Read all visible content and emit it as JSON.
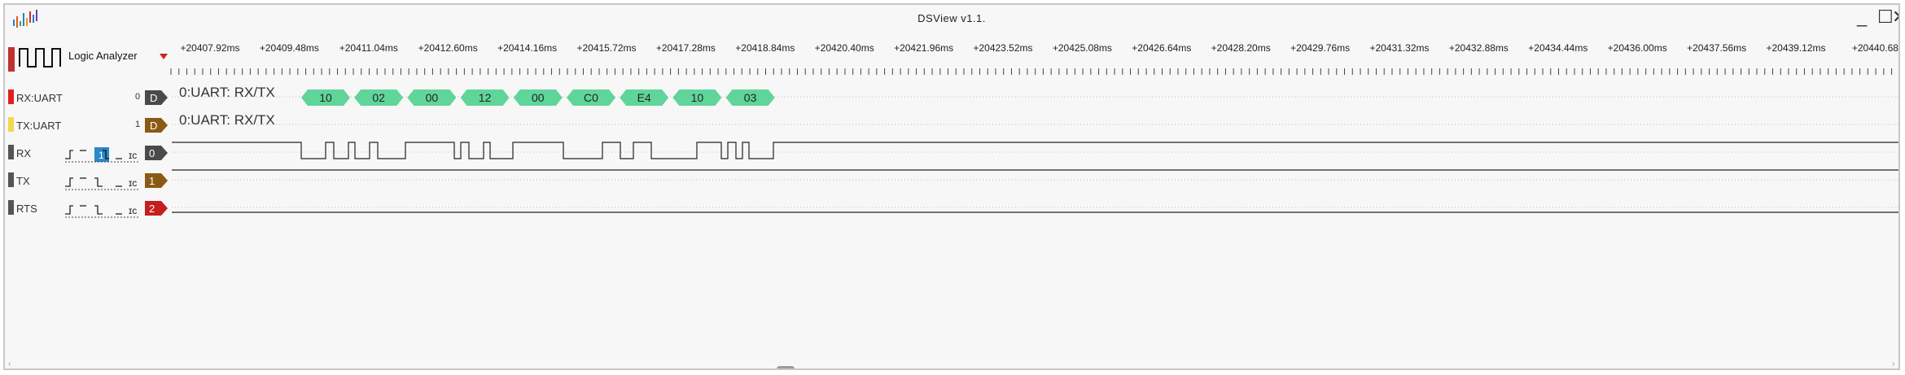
{
  "window": {
    "title": "DSView v1.1."
  },
  "toolbar": {
    "device_name": "Logic Analyzer"
  },
  "ruler": {
    "ticks": [
      "+20407.92ms",
      "+20409.48ms",
      "+20411.04ms",
      "+20412.60ms",
      "+20414.16ms",
      "+20415.72ms",
      "+20417.28ms",
      "+20418.84ms",
      "+20420.40ms",
      "+20421.96ms",
      "+20423.52ms",
      "+20425.08ms",
      "+20426.64ms",
      "+20428.20ms",
      "+20429.76ms",
      "+20431.32ms",
      "+20432.88ms",
      "+20434.44ms",
      "+20436.00ms",
      "+20437.56ms",
      "+20439.12ms",
      "+20440.68"
    ]
  },
  "channels": [
    {
      "label": "RX:UART",
      "index": "0",
      "tag": "D",
      "color": "#e02020",
      "tag_color": "#4a4a4a",
      "protocol": "0:UART: RX/TX"
    },
    {
      "label": "TX:UART",
      "index": "1",
      "tag": "D",
      "color": "#f4d84a",
      "tag_color": "#8a5a14",
      "protocol": "0:UART: RX/TX"
    },
    {
      "label": "RX",
      "tag": "0",
      "color": "#555555",
      "tag_color": "#4a4a4a",
      "trigger_value": "1"
    },
    {
      "label": "TX",
      "tag": "1",
      "color": "#555555",
      "tag_color": "#8a5a14"
    },
    {
      "label": "RTS",
      "tag": "2",
      "color": "#555555",
      "tag_color": "#c41e1e"
    }
  ],
  "decoded_bytes": [
    "10",
    "02",
    "00",
    "12",
    "00",
    "C0",
    "E4",
    "10",
    "03"
  ],
  "colors": {
    "decode_fill": "#5fd59a",
    "background": "#f7f7f7"
  },
  "icons": {
    "minimize": "minimize-icon",
    "maximize": "maximize-icon",
    "close": "close-icon"
  }
}
